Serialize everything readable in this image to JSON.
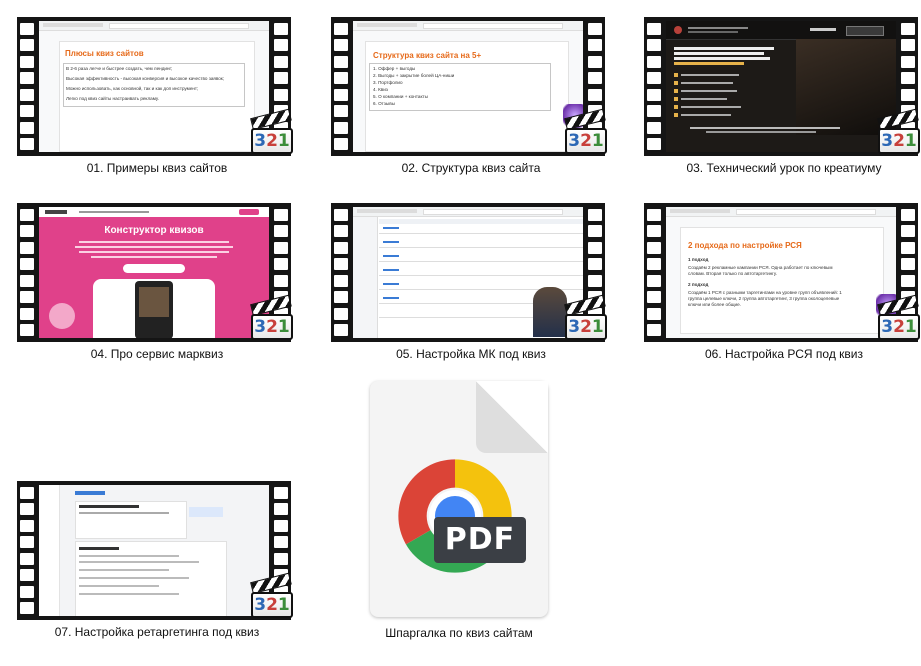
{
  "files": [
    {
      "caption": "01. Примеры квиз сайтов",
      "slide_title": "Плюсы квиз сайтов",
      "lines": [
        "В 2-6 раза легче и быстрее создать, чем лендинг;",
        "Высокая эффективность - высокая конверсия и высокое качество заявок;",
        "Можно использовать, как основной, так и как доп инструмент;",
        "Легко под квиз сайты настраивать рекламу."
      ]
    },
    {
      "caption": "02. Структура квиз сайта",
      "slide_title": "Структура квиз сайта на 5+",
      "lines": [
        "1.  Оффер + выгоды",
        "2.  Выгоды + закрытие болей ЦА-ниши",
        "3.  Портфолио",
        "4.  Квиз",
        "5.  О компании + контакты",
        "6.  Отзывы"
      ]
    },
    {
      "caption": "03. Технический урок по креатиуму"
    },
    {
      "caption": "04. Про сервис марквиз",
      "slide_title": "Конструктор квизов"
    },
    {
      "caption": "05. Настройка МК под квиз"
    },
    {
      "caption": "06. Настройка РСЯ под квиз",
      "slide_title": "2 подхода по настройке РСЯ",
      "lines": [
        "1 подход",
        "Создаём 2 рекламные кампании РСЯ. Одна работает по ключевым",
        "словам. Вторая только по автотаргетингу.",
        "2 подход",
        "Создаём 1 РСЯ с разными таргетингами на уровне групп объявлений: 1",
        "группа целевые ключи, 2 группа автотаргетинг, 3 группа околоцелевые",
        "ключи или более общие."
      ]
    },
    {
      "caption": "07. Настройка ретаргетинга под квиз"
    }
  ],
  "pdf": {
    "caption": "Шпаргалка по квиз сайтам",
    "label": "PDF",
    "icon": "chrome-pdf-icon"
  },
  "badge": {
    "digits": [
      "3",
      "2",
      "1"
    ]
  },
  "colors": {
    "slide_title": "#e66a1a",
    "marquiz_pink": "#e0418a",
    "film": "#151515"
  }
}
